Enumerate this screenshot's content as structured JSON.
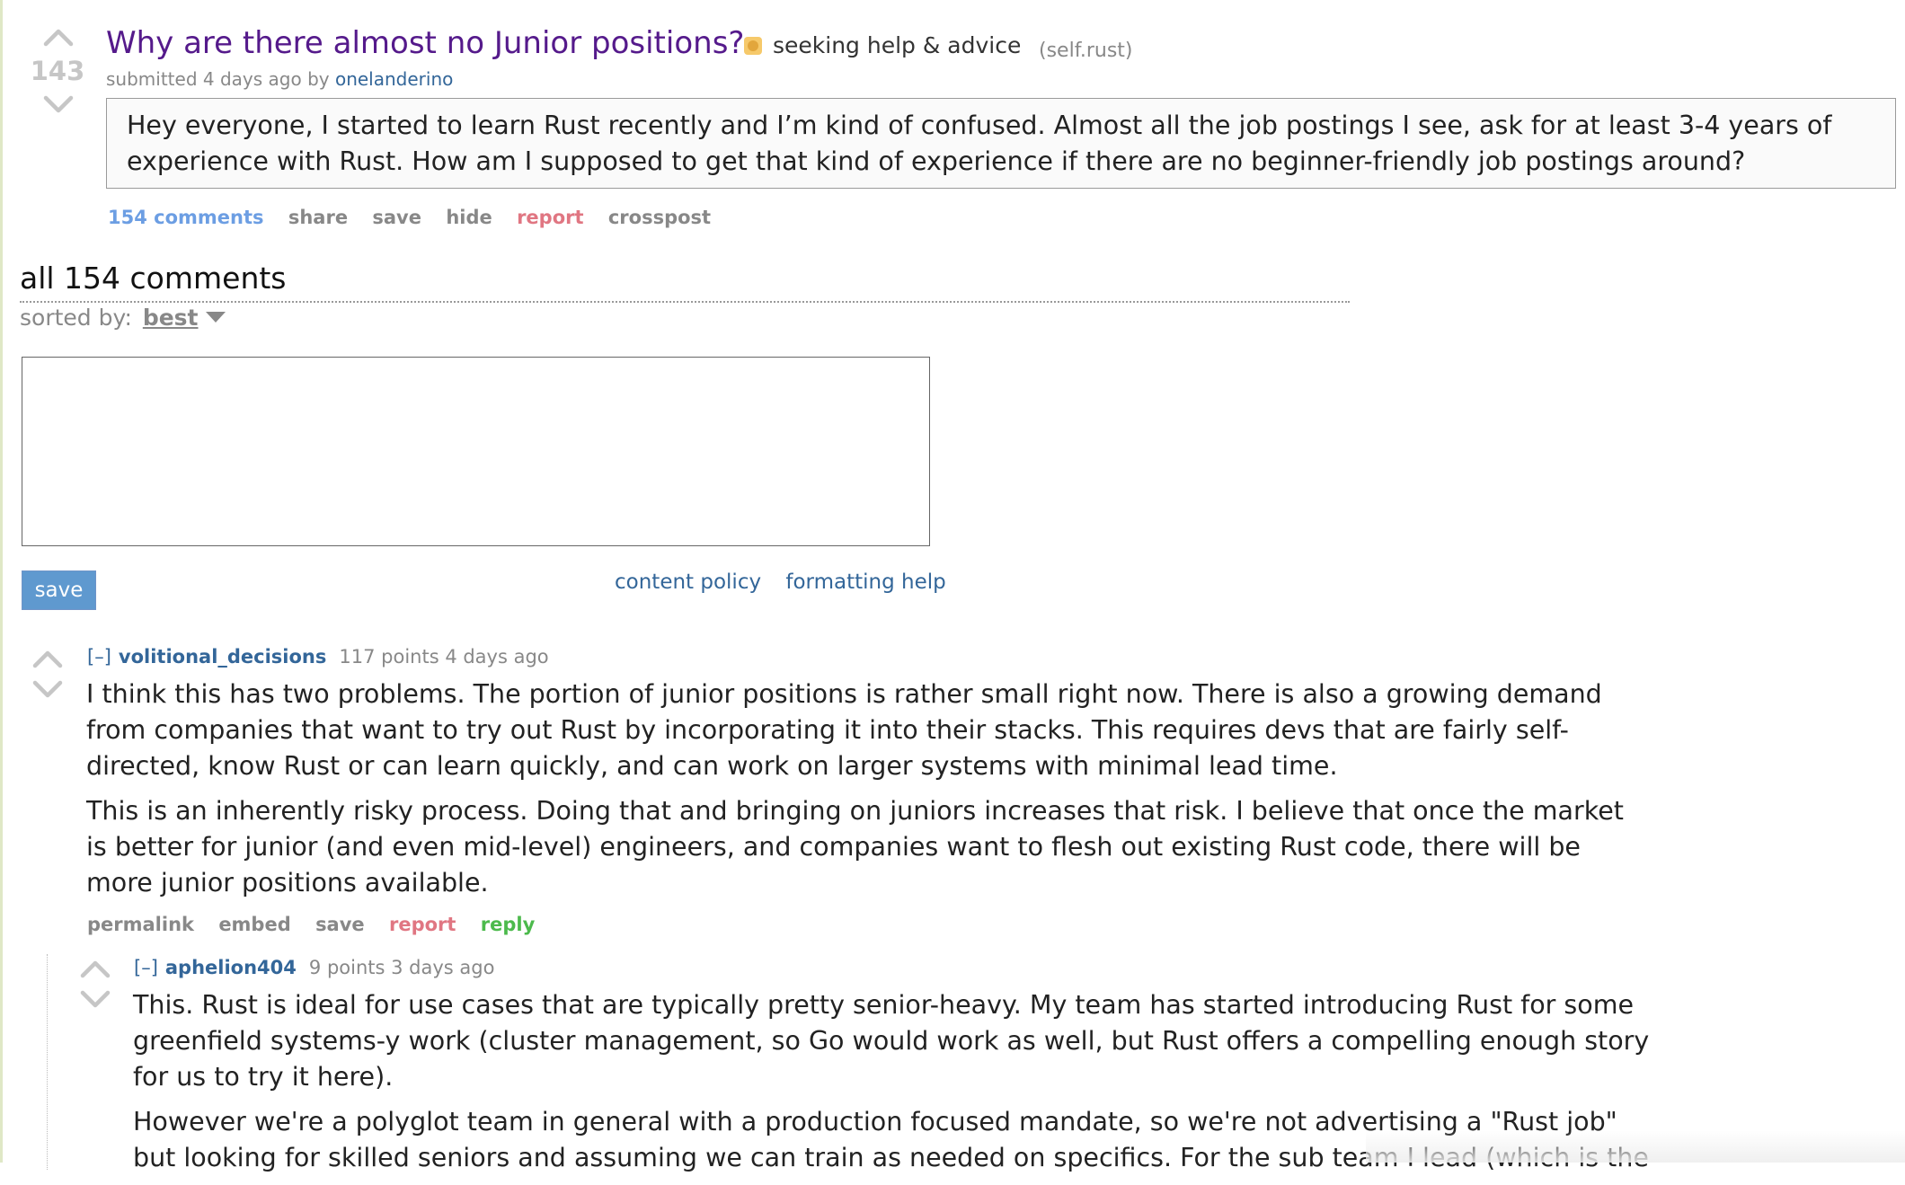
{
  "post": {
    "score": "143",
    "title": "Why are there almost no Junior positions?",
    "flair": "seeking help & advice",
    "domain": "(self.rust)",
    "submitted_prefix": "submitted 4 days ago by",
    "author": "onelanderino",
    "selftext": "Hey everyone, I started to learn Rust recently and I’m kind of confused. Almost all the job postings I see, ask for at least 3-4 years of experience with Rust. How am I supposed to get that kind of experience if there are no beginner-friendly job postings around?",
    "buttons": {
      "comments": "154 comments",
      "share": "share",
      "save": "save",
      "hide": "hide",
      "report": "report",
      "crosspost": "crosspost"
    }
  },
  "comments_area": {
    "title": "all 154 comments",
    "sorted_label": "sorted by:",
    "sorted_value": "best",
    "textarea_value": "",
    "save_label": "save",
    "content_policy": "content policy",
    "formatting_help": "formatting help"
  },
  "comments": [
    {
      "collapse": "[–]",
      "author": "volitional_decisions",
      "meta": "117 points 4 days ago",
      "paragraphs": [
        "I think this has two problems. The portion of junior positions is rather small right now. There is also a growing demand from companies that want to try out Rust by incorporating it into their stacks. This requires devs that are fairly self-directed, know Rust or can learn quickly, and can work on larger systems with minimal lead time.",
        "This is an inherently risky process. Doing that and bringing on juniors increases that risk. I believe that once the market is better for junior (and even mid-level) engineers, and companies want to flesh out existing Rust code, there will be more junior positions available."
      ],
      "buttons": {
        "permalink": "permalink",
        "embed": "embed",
        "save": "save",
        "report": "report",
        "reply": "reply"
      }
    },
    {
      "collapse": "[–]",
      "author": "aphelion404",
      "meta": "9 points 3 days ago",
      "paragraphs": [
        "This. Rust is ideal for use cases that are typically pretty senior-heavy. My team has started introducing Rust for some greenfield systems-y work (cluster management, so Go would work as well, but Rust offers a compelling enough story for us to try it here).",
        "However we're a polyglot team in general with a production focused mandate, so we're not advertising a \"Rust job\" but looking for skilled seniors and assuming we can train as needed on specifics. For the sub team I lead (which is the"
      ]
    }
  ],
  "colors": {
    "title_visited": "#551a8b",
    "link": "#336699",
    "comments_link": "#6c9ee3",
    "report": "#e07682",
    "reply": "#4cba4c",
    "save_button": "#5f99cf"
  }
}
